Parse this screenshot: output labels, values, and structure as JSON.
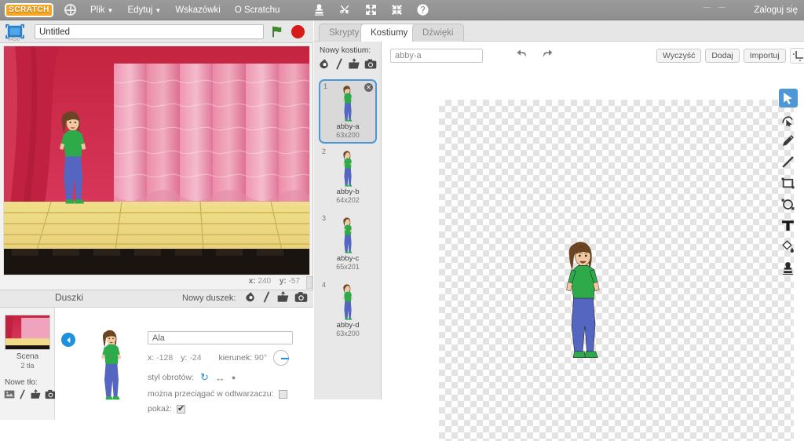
{
  "menubar": {
    "logo": "SCRATCH",
    "globe_icon": "globe-icon",
    "items": [
      {
        "label": "Plik",
        "has_caret": true
      },
      {
        "label": "Edytuj",
        "has_caret": true
      },
      {
        "label": "Wskazówki",
        "has_caret": false
      },
      {
        "label": "O Scratchu",
        "has_caret": false
      }
    ],
    "tools": [
      "stamp-icon",
      "scissors-icon",
      "grow-icon",
      "shrink-icon",
      "help-icon"
    ],
    "login": "Zaloguj się"
  },
  "project": {
    "title_value": "Untitled",
    "version": "v458",
    "green_flag": "green-flag-icon",
    "stop": "stop-button-icon",
    "fullscreen": "presentation-mode-icon"
  },
  "stage": {
    "coord_x_label": "x:",
    "coord_x_value": "240",
    "coord_y_label": "y:",
    "coord_y_value": "-57",
    "backdrop": "theater-curtain-stage"
  },
  "stage_panel": {
    "name": "Scena",
    "count": "2 tła",
    "new_backdrop_label": "Nowe tło:",
    "icons": [
      "paint-backdrop-icon",
      "surprise-backdrop-icon",
      "upload-backdrop-icon",
      "camera-backdrop-icon"
    ]
  },
  "sprites": {
    "header": "Duszki",
    "new_sprite_label": "Nowy duszek:",
    "icons": [
      "paint-sprite-icon",
      "surprise-sprite-icon",
      "upload-sprite-icon",
      "camera-sprite-icon"
    ],
    "back_arrow": "back-arrow-icon"
  },
  "sprite_info": {
    "name_value": "Ala",
    "x_label": "x:",
    "x_value": "-128",
    "y_label": "y:",
    "y_value": "-24",
    "direction_label": "kierunek:",
    "direction_value": "90°",
    "rotation_label": "styl obrotów:",
    "rotation_options": [
      "all-around-icon",
      "left-right-icon",
      "dont-rotate-icon"
    ],
    "draggable_label": "można przeciągać w odtwarzaczu:",
    "draggable_checked": false,
    "show_label": "pokaż:",
    "show_checked": true
  },
  "tabs": [
    {
      "label": "Skrypty",
      "active": false
    },
    {
      "label": "Kostiumy",
      "active": true
    },
    {
      "label": "Dźwięki",
      "active": false
    }
  ],
  "costume_panel": {
    "new_costume_label": "Nowy kostium:",
    "icons": [
      "paint-costume-icon",
      "surprise-costume-icon",
      "upload-costume-icon",
      "camera-costume-icon"
    ],
    "items": [
      {
        "num": "1",
        "name": "abby-a",
        "size": "63x200",
        "selected": true
      },
      {
        "num": "2",
        "name": "abby-b",
        "size": "64x202",
        "selected": false
      },
      {
        "num": "3",
        "name": "abby-c",
        "size": "65x201",
        "selected": false
      },
      {
        "num": "4",
        "name": "abby-d",
        "size": "63x200",
        "selected": false
      }
    ]
  },
  "paint_editor": {
    "costume_name_value": "abby-a",
    "undo_icon": "undo-icon",
    "redo_icon": "redo-icon",
    "buttons": [
      {
        "label": "Wyczyść",
        "name": "clear-button"
      },
      {
        "label": "Dodaj",
        "name": "add-button"
      },
      {
        "label": "Importuj",
        "name": "import-button"
      }
    ],
    "top_right_tools": [
      "crop-icon",
      "flip-horizontal-icon",
      "flip-vertical-icon",
      "set-center-icon"
    ],
    "tools": [
      {
        "name": "select-tool",
        "icon": "arrow-cursor-icon",
        "active": true
      },
      {
        "name": "reshape-tool",
        "icon": "reshape-icon",
        "active": false
      },
      {
        "name": "pencil-tool",
        "icon": "pencil-icon",
        "active": false
      },
      {
        "name": "line-tool",
        "icon": "line-icon",
        "active": false
      },
      {
        "name": "rectangle-tool",
        "icon": "rectangle-icon",
        "active": false
      },
      {
        "name": "ellipse-tool",
        "icon": "ellipse-icon",
        "active": false
      },
      {
        "name": "text-tool",
        "icon": "text-t-icon",
        "active": false
      },
      {
        "name": "fill-tool",
        "icon": "paint-bucket-icon",
        "active": false
      },
      {
        "name": "stamp-tool",
        "icon": "stamp-icon",
        "active": false
      }
    ],
    "canvas_content": "abby-a-costume"
  },
  "colors": {
    "menubar_bg": "#949494",
    "accent_blue": "#4d97d6",
    "stop_red": "#d61b1b",
    "flag_green": "#3a8c2a",
    "panel_bg": "#e8e8e8"
  }
}
